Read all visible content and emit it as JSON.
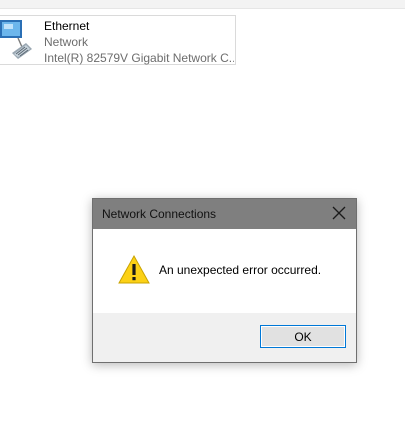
{
  "connection": {
    "name": "Ethernet",
    "status": "Network",
    "adapter": "Intel(R) 82579V Gigabit Network C...",
    "icon": "network-adapter-icon"
  },
  "dialog": {
    "title": "Network Connections",
    "message": "An unexpected error occurred.",
    "ok_label": "OK",
    "icon": "warning-icon",
    "close_icon": "close-icon"
  },
  "colors": {
    "titlebar": "#7f7f7f",
    "footer": "#f0f0f0",
    "button_border": "#0078d7",
    "warning_yellow": "#fcd116"
  }
}
